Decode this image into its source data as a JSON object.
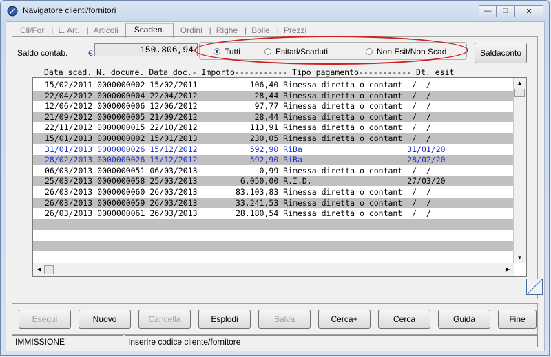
{
  "window": {
    "title": "Navigatore clienti/fornitori"
  },
  "tabs": [
    {
      "label": "Cli/For",
      "active": false
    },
    {
      "label": "L. Art.",
      "active": false
    },
    {
      "label": "Articoli",
      "active": false
    },
    {
      "label": "Scaden.",
      "active": true
    },
    {
      "label": "Ordini",
      "active": false
    },
    {
      "label": "Righe",
      "active": false
    },
    {
      "label": "Bolle",
      "active": false
    },
    {
      "label": "Prezzi",
      "active": false
    }
  ],
  "saldo": {
    "label": "Saldo contab.",
    "currency": "€",
    "value": "150.806,94"
  },
  "filters": [
    {
      "label": "Tutti",
      "selected": true
    },
    {
      "label": "Esitati/Scaduti",
      "selected": false
    },
    {
      "label": "Non Esit/Non Scad",
      "selected": false
    }
  ],
  "saldaconto_label": "Saldaconto",
  "grid": {
    "header": "Data scad. N. docume. Data doc.- Importo----------- Tipo pagamento----------- Dt. esit",
    "rows": [
      {
        "text": "15/02/2011 0000000002 15/02/2011           106,40 Rimessa diretta o contant  /  /",
        "shade": false,
        "blue": false
      },
      {
        "text": "22/04/2012 0000000004 22/04/2012            28,44 Rimessa diretta o contant  /  /",
        "shade": true,
        "blue": false
      },
      {
        "text": "12/06/2012 0000000006 12/06/2012            97,77 Rimessa diretta o contant  /  /",
        "shade": false,
        "blue": false
      },
      {
        "text": "21/09/2012 0000000005 21/09/2012            28,44 Rimessa diretta o contant  /  /",
        "shade": true,
        "blue": false
      },
      {
        "text": "22/11/2012 0000000015 22/10/2012           113,91 Rimessa diretta o contant  /  /",
        "shade": false,
        "blue": false
      },
      {
        "text": "15/01/2013 0000000002 15/01/2013           230,05 Rimessa diretta o contant  /  /",
        "shade": true,
        "blue": false
      },
      {
        "text": "31/01/2013 0000000026 15/12/2012           592,90 RiBa                      31/01/20",
        "shade": false,
        "blue": true
      },
      {
        "text": "28/02/2013 0000000026 15/12/2012           592,90 RiBa                      28/02/20",
        "shade": true,
        "blue": true
      },
      {
        "text": "06/03/2013 0000000051 06/03/2013             0,99 Rimessa diretta o contant  /  /",
        "shade": false,
        "blue": false
      },
      {
        "text": "25/03/2013 0000000058 25/03/2013         6.050,00 R.I.D.                    27/03/20",
        "shade": true,
        "blue": false
      },
      {
        "text": "26/03/2013 0000000060 26/03/2013        83.103,83 Rimessa diretta o contant  /  /",
        "shade": false,
        "blue": false
      },
      {
        "text": "26/03/2013 0000000059 26/03/2013        33.241,53 Rimessa diretta o contant  /  /",
        "shade": true,
        "blue": false
      },
      {
        "text": "26/03/2013 0000000061 26/03/2013        28.180,54 Rimessa diretta o contant  /  /",
        "shade": false,
        "blue": false
      },
      {
        "text": "",
        "shade": true,
        "blue": false
      },
      {
        "text": "",
        "shade": false,
        "blue": false
      },
      {
        "text": "",
        "shade": true,
        "blue": false
      }
    ]
  },
  "buttons": [
    {
      "label": "Esegui",
      "enabled": false
    },
    {
      "label": "Nuovo",
      "enabled": true
    },
    {
      "label": "Cancella",
      "enabled": false
    },
    {
      "label": "Esplodi",
      "enabled": true
    },
    {
      "label": "Salva",
      "enabled": false
    },
    {
      "label": "Cerca+",
      "enabled": true
    },
    {
      "label": "Cerca",
      "enabled": true
    },
    {
      "label": "Guida",
      "enabled": true
    },
    {
      "label": "Fine",
      "enabled": true
    }
  ],
  "status": {
    "mode": "IMMISSIONE",
    "message": "Inserire codice cliente/fornitore"
  },
  "colors": {
    "highlight_oval": "#d02020",
    "blue_rows": "#2030d0",
    "shade_rows": "#c0c0c0"
  }
}
